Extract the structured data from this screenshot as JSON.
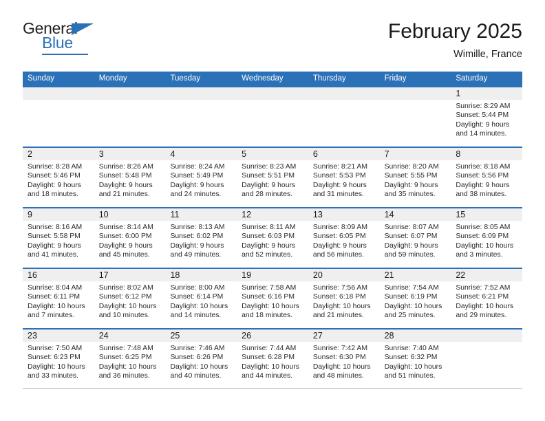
{
  "brand": {
    "name_part1": "General",
    "name_part2": "Blue"
  },
  "header": {
    "month_title": "February 2025",
    "location": "Wimille, France"
  },
  "weekdays": [
    "Sunday",
    "Monday",
    "Tuesday",
    "Wednesday",
    "Thursday",
    "Friday",
    "Saturday"
  ],
  "colors": {
    "header_blue": "#2b71b8",
    "band_gray": "#efefef",
    "text": "#1a1a1a"
  },
  "weeks": [
    [
      {
        "day": "",
        "sunrise": "",
        "sunset": "",
        "daylight1": "",
        "daylight2": ""
      },
      {
        "day": "",
        "sunrise": "",
        "sunset": "",
        "daylight1": "",
        "daylight2": ""
      },
      {
        "day": "",
        "sunrise": "",
        "sunset": "",
        "daylight1": "",
        "daylight2": ""
      },
      {
        "day": "",
        "sunrise": "",
        "sunset": "",
        "daylight1": "",
        "daylight2": ""
      },
      {
        "day": "",
        "sunrise": "",
        "sunset": "",
        "daylight1": "",
        "daylight2": ""
      },
      {
        "day": "",
        "sunrise": "",
        "sunset": "",
        "daylight1": "",
        "daylight2": ""
      },
      {
        "day": "1",
        "sunrise": "Sunrise: 8:29 AM",
        "sunset": "Sunset: 5:44 PM",
        "daylight1": "Daylight: 9 hours",
        "daylight2": "and 14 minutes."
      }
    ],
    [
      {
        "day": "2",
        "sunrise": "Sunrise: 8:28 AM",
        "sunset": "Sunset: 5:46 PM",
        "daylight1": "Daylight: 9 hours",
        "daylight2": "and 18 minutes."
      },
      {
        "day": "3",
        "sunrise": "Sunrise: 8:26 AM",
        "sunset": "Sunset: 5:48 PM",
        "daylight1": "Daylight: 9 hours",
        "daylight2": "and 21 minutes."
      },
      {
        "day": "4",
        "sunrise": "Sunrise: 8:24 AM",
        "sunset": "Sunset: 5:49 PM",
        "daylight1": "Daylight: 9 hours",
        "daylight2": "and 24 minutes."
      },
      {
        "day": "5",
        "sunrise": "Sunrise: 8:23 AM",
        "sunset": "Sunset: 5:51 PM",
        "daylight1": "Daylight: 9 hours",
        "daylight2": "and 28 minutes."
      },
      {
        "day": "6",
        "sunrise": "Sunrise: 8:21 AM",
        "sunset": "Sunset: 5:53 PM",
        "daylight1": "Daylight: 9 hours",
        "daylight2": "and 31 minutes."
      },
      {
        "day": "7",
        "sunrise": "Sunrise: 8:20 AM",
        "sunset": "Sunset: 5:55 PM",
        "daylight1": "Daylight: 9 hours",
        "daylight2": "and 35 minutes."
      },
      {
        "day": "8",
        "sunrise": "Sunrise: 8:18 AM",
        "sunset": "Sunset: 5:56 PM",
        "daylight1": "Daylight: 9 hours",
        "daylight2": "and 38 minutes."
      }
    ],
    [
      {
        "day": "9",
        "sunrise": "Sunrise: 8:16 AM",
        "sunset": "Sunset: 5:58 PM",
        "daylight1": "Daylight: 9 hours",
        "daylight2": "and 41 minutes."
      },
      {
        "day": "10",
        "sunrise": "Sunrise: 8:14 AM",
        "sunset": "Sunset: 6:00 PM",
        "daylight1": "Daylight: 9 hours",
        "daylight2": "and 45 minutes."
      },
      {
        "day": "11",
        "sunrise": "Sunrise: 8:13 AM",
        "sunset": "Sunset: 6:02 PM",
        "daylight1": "Daylight: 9 hours",
        "daylight2": "and 49 minutes."
      },
      {
        "day": "12",
        "sunrise": "Sunrise: 8:11 AM",
        "sunset": "Sunset: 6:03 PM",
        "daylight1": "Daylight: 9 hours",
        "daylight2": "and 52 minutes."
      },
      {
        "day": "13",
        "sunrise": "Sunrise: 8:09 AM",
        "sunset": "Sunset: 6:05 PM",
        "daylight1": "Daylight: 9 hours",
        "daylight2": "and 56 minutes."
      },
      {
        "day": "14",
        "sunrise": "Sunrise: 8:07 AM",
        "sunset": "Sunset: 6:07 PM",
        "daylight1": "Daylight: 9 hours",
        "daylight2": "and 59 minutes."
      },
      {
        "day": "15",
        "sunrise": "Sunrise: 8:05 AM",
        "sunset": "Sunset: 6:09 PM",
        "daylight1": "Daylight: 10 hours",
        "daylight2": "and 3 minutes."
      }
    ],
    [
      {
        "day": "16",
        "sunrise": "Sunrise: 8:04 AM",
        "sunset": "Sunset: 6:11 PM",
        "daylight1": "Daylight: 10 hours",
        "daylight2": "and 7 minutes."
      },
      {
        "day": "17",
        "sunrise": "Sunrise: 8:02 AM",
        "sunset": "Sunset: 6:12 PM",
        "daylight1": "Daylight: 10 hours",
        "daylight2": "and 10 minutes."
      },
      {
        "day": "18",
        "sunrise": "Sunrise: 8:00 AM",
        "sunset": "Sunset: 6:14 PM",
        "daylight1": "Daylight: 10 hours",
        "daylight2": "and 14 minutes."
      },
      {
        "day": "19",
        "sunrise": "Sunrise: 7:58 AM",
        "sunset": "Sunset: 6:16 PM",
        "daylight1": "Daylight: 10 hours",
        "daylight2": "and 18 minutes."
      },
      {
        "day": "20",
        "sunrise": "Sunrise: 7:56 AM",
        "sunset": "Sunset: 6:18 PM",
        "daylight1": "Daylight: 10 hours",
        "daylight2": "and 21 minutes."
      },
      {
        "day": "21",
        "sunrise": "Sunrise: 7:54 AM",
        "sunset": "Sunset: 6:19 PM",
        "daylight1": "Daylight: 10 hours",
        "daylight2": "and 25 minutes."
      },
      {
        "day": "22",
        "sunrise": "Sunrise: 7:52 AM",
        "sunset": "Sunset: 6:21 PM",
        "daylight1": "Daylight: 10 hours",
        "daylight2": "and 29 minutes."
      }
    ],
    [
      {
        "day": "23",
        "sunrise": "Sunrise: 7:50 AM",
        "sunset": "Sunset: 6:23 PM",
        "daylight1": "Daylight: 10 hours",
        "daylight2": "and 33 minutes."
      },
      {
        "day": "24",
        "sunrise": "Sunrise: 7:48 AM",
        "sunset": "Sunset: 6:25 PM",
        "daylight1": "Daylight: 10 hours",
        "daylight2": "and 36 minutes."
      },
      {
        "day": "25",
        "sunrise": "Sunrise: 7:46 AM",
        "sunset": "Sunset: 6:26 PM",
        "daylight1": "Daylight: 10 hours",
        "daylight2": "and 40 minutes."
      },
      {
        "day": "26",
        "sunrise": "Sunrise: 7:44 AM",
        "sunset": "Sunset: 6:28 PM",
        "daylight1": "Daylight: 10 hours",
        "daylight2": "and 44 minutes."
      },
      {
        "day": "27",
        "sunrise": "Sunrise: 7:42 AM",
        "sunset": "Sunset: 6:30 PM",
        "daylight1": "Daylight: 10 hours",
        "daylight2": "and 48 minutes."
      },
      {
        "day": "28",
        "sunrise": "Sunrise: 7:40 AM",
        "sunset": "Sunset: 6:32 PM",
        "daylight1": "Daylight: 10 hours",
        "daylight2": "and 51 minutes."
      },
      {
        "day": "",
        "sunrise": "",
        "sunset": "",
        "daylight1": "",
        "daylight2": ""
      }
    ]
  ]
}
